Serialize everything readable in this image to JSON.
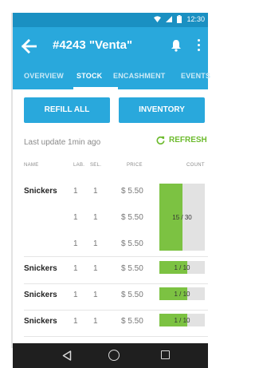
{
  "status_bar": {
    "time": "12:30",
    "icons": [
      "wifi-icon",
      "signal-icon",
      "battery-icon"
    ]
  },
  "app_bar": {
    "title": "#4243 \"Venta\"",
    "icons": [
      "back-arrow-icon",
      "bell-icon",
      "more-vert-icon"
    ]
  },
  "tabs": [
    {
      "label": "OVERVIEW"
    },
    {
      "label": "STOCK"
    },
    {
      "label": "ENCASHMENT"
    },
    {
      "label": "EVENTS"
    }
  ],
  "active_tab": "STOCK",
  "actions": {
    "refill_all": "REFILL ALL",
    "inventory": "INVENTORY"
  },
  "last_update": "Last update 1min ago",
  "refresh": "REFRESH",
  "columns": {
    "name": "NAME",
    "lab": "LAB.",
    "sel": "SEL.",
    "price": "PRICE",
    "count": "COUNT"
  },
  "group": {
    "name": "Snickers",
    "rows": [
      {
        "lab": "1",
        "sel": "1",
        "price": "$ 5.50"
      },
      {
        "lab": "1",
        "sel": "1",
        "price": "$ 5.50"
      },
      {
        "lab": "1",
        "sel": "1",
        "price": "$ 5.50"
      }
    ],
    "count": "15 / 30",
    "fill": 0.5
  },
  "rows": [
    {
      "name": "Snickers",
      "lab": "1",
      "sel": "1",
      "price": "$ 5.50",
      "count": "1 / 10",
      "fill": 0.62
    },
    {
      "name": "Snickers",
      "lab": "1",
      "sel": "1",
      "price": "$ 5.50",
      "count": "1 / 10",
      "fill": 0.62
    },
    {
      "name": "Snickers",
      "lab": "1",
      "sel": "1",
      "price": "$ 5.50",
      "count": "1 / 10",
      "fill": 0.62
    }
  ],
  "colors": {
    "primary": "#29a8dc",
    "status_bar": "#1a90c2",
    "accent_green": "#7cc242",
    "refresh_green": "#6dbb2e"
  }
}
